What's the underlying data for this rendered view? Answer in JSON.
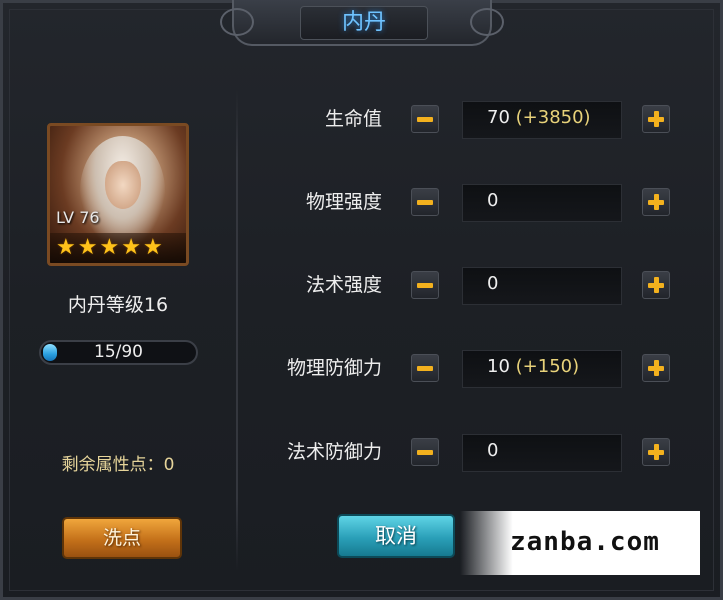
{
  "title": "内丹",
  "portrait": {
    "level_text": "LV 76",
    "stars": 5
  },
  "neidan_level": "内丹等级16",
  "xp": {
    "text": "15/90",
    "current": 15,
    "max": 90
  },
  "remaining_points": "剩余属性点：0",
  "buttons": {
    "wash": "洗点",
    "cancel": "取消"
  },
  "attributes": [
    {
      "label": "生命值",
      "value": "70",
      "bonus": "(+3850)"
    },
    {
      "label": "物理强度",
      "value": "0",
      "bonus": ""
    },
    {
      "label": "法术强度",
      "value": "0",
      "bonus": ""
    },
    {
      "label": "物理防御力",
      "value": "10",
      "bonus": "(+150)"
    },
    {
      "label": "法术防御力",
      "value": "0",
      "bonus": ""
    }
  ],
  "watermark": "zanba.com",
  "colors": {
    "accent_title": "#6fc3ff",
    "bonus": "#e8d27a",
    "plus_minus": "#f3b11e"
  }
}
